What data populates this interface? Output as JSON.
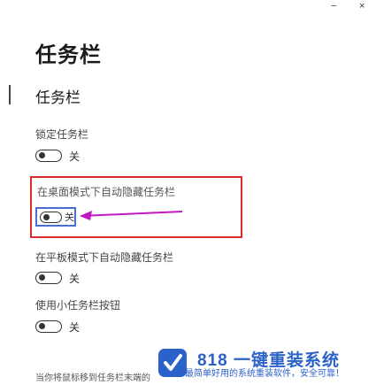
{
  "window": {
    "minimize_glyph": "−",
    "close_glyph": "×"
  },
  "page": {
    "title": "任务栏",
    "section_heading": "任务栏"
  },
  "settings": [
    {
      "label": "锁定任务栏",
      "state": "关",
      "on": false
    },
    {
      "label": "在桌面模式下自动隐藏任务栏",
      "state": "关",
      "on": false,
      "highlighted": true
    },
    {
      "label": "在平板模式下自动隐藏任务栏",
      "state": "关",
      "on": false
    },
    {
      "label": "使用小任务栏按钮",
      "state": "关",
      "on": false
    }
  ],
  "footer": {
    "text": "当你将鼠标移到任务栏末端的"
  },
  "watermark": {
    "title": "818 一键重装系统",
    "subtitle": "最简单好用的系统重装软件，安全可靠！",
    "brand_color": "#2a62c9"
  },
  "colors": {
    "highlight_border": "#d92b2b",
    "focus_border": "#4a6fd0",
    "arrow": "#c018c0"
  }
}
